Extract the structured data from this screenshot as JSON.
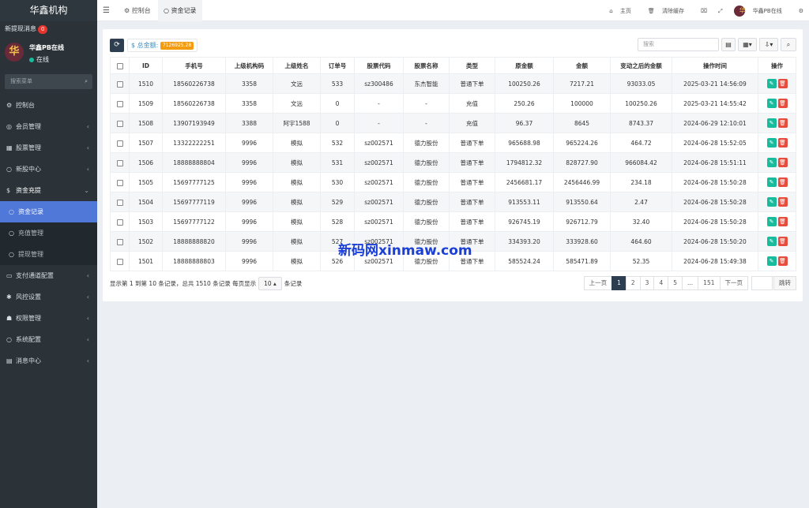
{
  "brand": "华鑫机构",
  "notice": {
    "label": "新提现消息",
    "count": "0"
  },
  "user": {
    "avatar_char": "华",
    "name": "华鑫PB在线",
    "status": "在线"
  },
  "sidebar_search": {
    "placeholder": "搜索菜单",
    "icon": "search-icon"
  },
  "sidebar": {
    "items": [
      {
        "key": "dashboard",
        "icon": "dashboard-icon",
        "glyph": "⚙",
        "label": "控制台"
      },
      {
        "key": "members",
        "icon": "users-icon",
        "glyph": "◎",
        "label": "会员管理"
      },
      {
        "key": "stocks",
        "icon": "bank-icon",
        "glyph": "▦",
        "label": "股票管理"
      },
      {
        "key": "ipo",
        "icon": "circle-icon",
        "glyph": "○",
        "label": "新股中心"
      },
      {
        "key": "funds",
        "icon": "dollar-icon",
        "glyph": "$",
        "label": "资金充提"
      }
    ],
    "sub_items": [
      {
        "key": "fund-records",
        "label": "资金记录"
      },
      {
        "key": "recharge",
        "label": "充值管理"
      },
      {
        "key": "withdraw",
        "label": "提现管理"
      }
    ],
    "items_after": [
      {
        "key": "payment",
        "icon": "credit-card-icon",
        "glyph": "▭",
        "label": "支付通道配置"
      },
      {
        "key": "risk",
        "icon": "gear-icon",
        "glyph": "✱",
        "label": "风控设置"
      },
      {
        "key": "permissions",
        "icon": "group-icon",
        "glyph": "☗",
        "label": "权限管理"
      },
      {
        "key": "system",
        "icon": "circle-icon",
        "glyph": "○",
        "label": "系统配置"
      },
      {
        "key": "messages",
        "icon": "inbox-icon",
        "glyph": "▤",
        "label": "消息中心"
      }
    ]
  },
  "topbar": {
    "tabs": [
      {
        "label": "控制台",
        "icon": "dashboard-icon"
      },
      {
        "label": "资金记录",
        "icon": "circle-icon"
      }
    ],
    "home": "主页",
    "clear_cache": "清除缓存",
    "user_name": "华鑫PB在线"
  },
  "toolbar": {
    "total_label": "$ 总金额:",
    "total_value": "7126925.28",
    "search_placeholder": "搜索"
  },
  "table": {
    "headers": [
      "ID",
      "手机号",
      "上级机构码",
      "上级姓名",
      "订单号",
      "股票代码",
      "股票名称",
      "类型",
      "原金额",
      "金额",
      "变动之后的金额",
      "操作时间",
      "操作"
    ],
    "rows": [
      [
        "1510",
        "18560226738",
        "3358",
        "文远",
        "533",
        "sz300486",
        "东杰智能",
        "普通下单",
        "100250.26",
        "7217.21",
        "93033.05",
        "2025-03-21 14:56:09"
      ],
      [
        "1509",
        "18560226738",
        "3358",
        "文远",
        "0",
        "-",
        "-",
        "充值",
        "250.26",
        "100000",
        "100250.26",
        "2025-03-21 14:55:42"
      ],
      [
        "1508",
        "13907193949",
        "3388",
        "阿宇1588",
        "0",
        "-",
        "-",
        "充值",
        "96.37",
        "8645",
        "8743.37",
        "2024-06-29 12:10:01"
      ],
      [
        "1507",
        "13322222251",
        "9996",
        "模拟",
        "532",
        "sz002571",
        "德力股份",
        "普通下单",
        "965688.98",
        "965224.26",
        "464.72",
        "2024-06-28 15:52:05"
      ],
      [
        "1506",
        "18888888804",
        "9996",
        "模拟",
        "531",
        "sz002571",
        "德力股份",
        "普通下单",
        "1794812.32",
        "828727.90",
        "966084.42",
        "2024-06-28 15:51:11"
      ],
      [
        "1505",
        "15697777125",
        "9996",
        "模拟",
        "530",
        "sz002571",
        "德力股份",
        "普通下单",
        "2456681.17",
        "2456446.99",
        "234.18",
        "2024-06-28 15:50:28"
      ],
      [
        "1504",
        "15697777119",
        "9996",
        "模拟",
        "529",
        "sz002571",
        "德力股份",
        "普通下单",
        "913553.11",
        "913550.64",
        "2.47",
        "2024-06-28 15:50:28"
      ],
      [
        "1503",
        "15697777122",
        "9996",
        "模拟",
        "528",
        "sz002571",
        "德力股份",
        "普通下单",
        "926745.19",
        "926712.79",
        "32.40",
        "2024-06-28 15:50:28"
      ],
      [
        "1502",
        "18888888820",
        "9996",
        "模拟",
        "527",
        "sz002571",
        "德力股份",
        "普通下单",
        "334393.20",
        "333928.60",
        "464.60",
        "2024-06-28 15:50:20"
      ],
      [
        "1501",
        "18888888803",
        "9996",
        "模拟",
        "526",
        "sz002571",
        "德力股份",
        "普通下单",
        "585524.24",
        "585471.89",
        "52.35",
        "2024-06-28 15:49:38"
      ]
    ]
  },
  "footer": {
    "info_prefix": "显示第 1 到第 10 条记录，总共 1510 条记录 每页显示",
    "page_size": "10",
    "info_suffix": "条记录"
  },
  "pagination": {
    "prev": "上一页",
    "pages": [
      "1",
      "2",
      "3",
      "4",
      "5",
      "...",
      "151"
    ],
    "active": "1",
    "next": "下一页",
    "jump": "跳转"
  },
  "watermark": "新码网xinmaw.com",
  "colors": {
    "sidebar_bg": "#2b3338",
    "active_blue": "#4f78d8",
    "dark_btn": "#2c3e50",
    "edit": "#18bc9c",
    "delete": "#e74c3c",
    "badge": "#e6352c",
    "total_badge": "#f39c12",
    "link": "#3c8dbc"
  }
}
